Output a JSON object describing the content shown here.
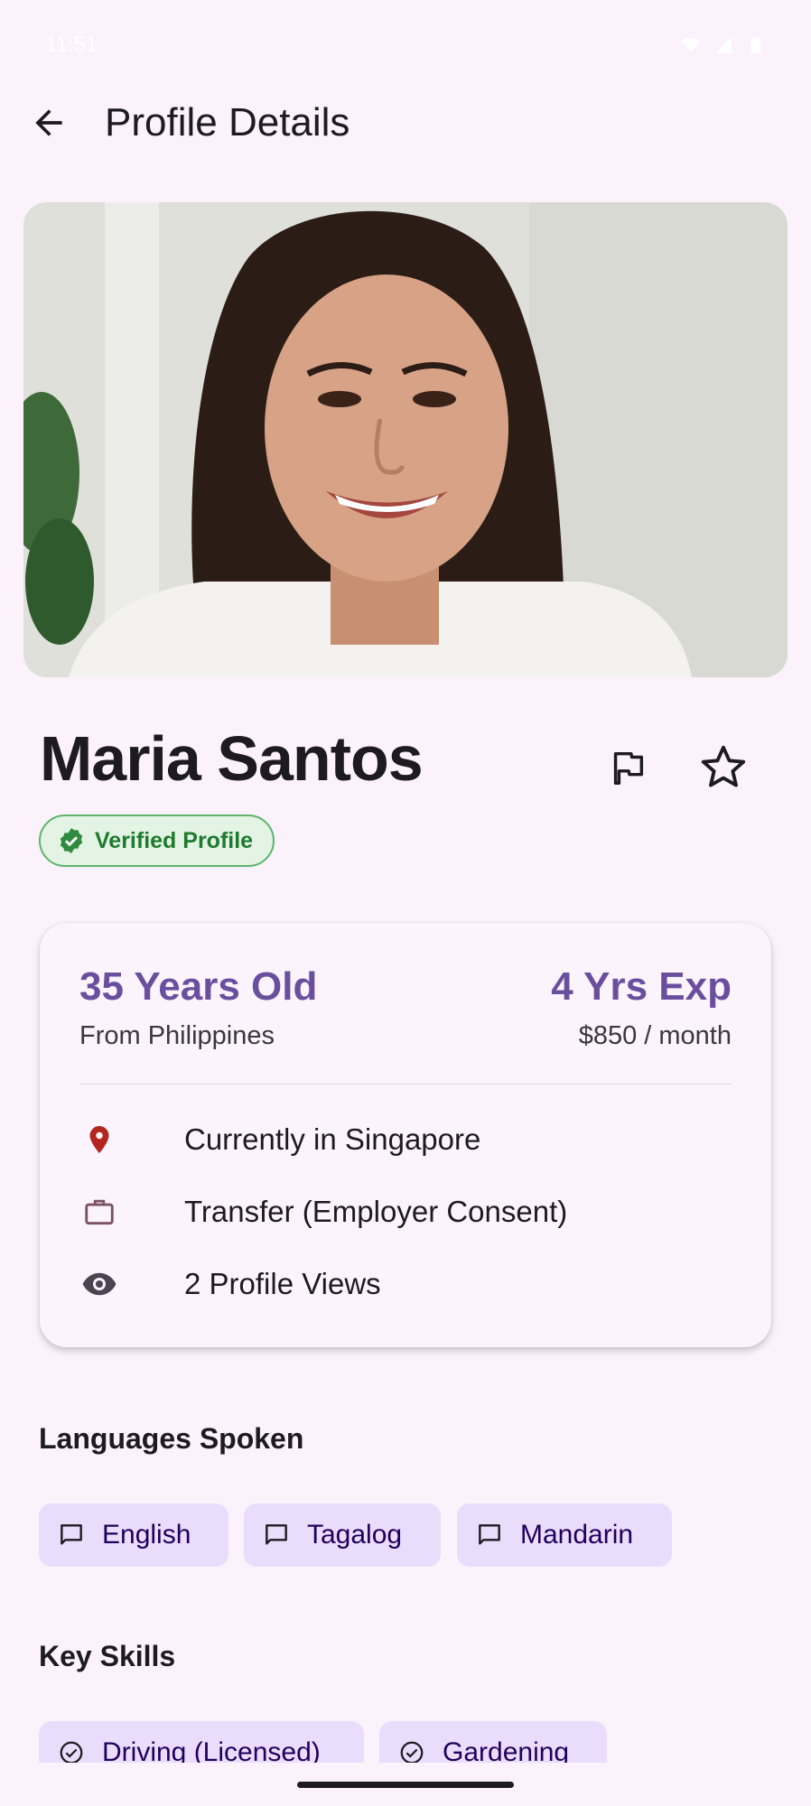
{
  "status_bar": {
    "time": "11:51"
  },
  "header": {
    "title": "Profile Details"
  },
  "profile": {
    "name": "Maria Santos",
    "verified_label": "Verified Profile"
  },
  "summary": {
    "age": "35 Years Old",
    "origin": "From Philippines",
    "experience": "4 Yrs Exp",
    "salary": "$850 / month",
    "details": [
      {
        "icon": "location-pin-icon",
        "text": "Currently in Singapore"
      },
      {
        "icon": "briefcase-icon",
        "text": "Transfer (Employer Consent)"
      },
      {
        "icon": "eye-icon",
        "text": "2 Profile Views"
      }
    ]
  },
  "languages": {
    "title": "Languages Spoken",
    "items": [
      "English",
      "Tagalog",
      "Mandarin"
    ]
  },
  "skills": {
    "title": "Key Skills",
    "items": [
      "Driving (Licensed)",
      "Gardening"
    ]
  },
  "colors": {
    "accent": "#6a4f9e",
    "chip": "#eaddfc",
    "verified": "#1e7a2e",
    "location_pin": "#b3261e"
  }
}
